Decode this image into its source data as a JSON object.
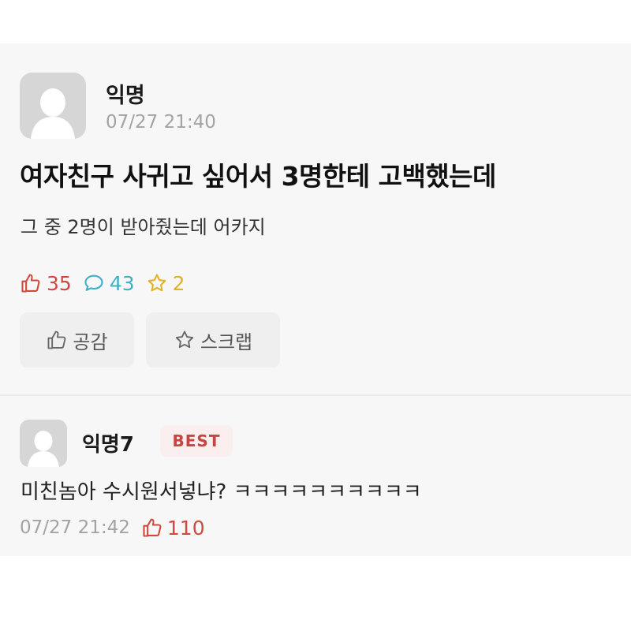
{
  "post": {
    "author": "익명",
    "date": "07/27 21:40",
    "title": "여자친구 사귀고 싶어서 3명한테 고백했는데",
    "body": "그 중 2명이 받아줬는데 어카지",
    "stats": {
      "likes": "35",
      "comments": "43",
      "scraps": "2"
    },
    "actions": {
      "empathy_label": "공감",
      "scrap_label": "스크랩"
    }
  },
  "comment": {
    "author": "익명7",
    "badge": "BEST",
    "text": "미친놈아 수시원서넣냐? ㅋㅋㅋㅋㅋㅋㅋㅋㅋㅋ",
    "date": "07/27 21:42",
    "likes": "110"
  },
  "colors": {
    "like": "#cf4a3c",
    "comment": "#3fb0c7",
    "scrap": "#e3b12d",
    "best_badge_text": "#c94343",
    "best_badge_bg": "#fbeeee"
  },
  "icons": [
    "avatar-placeholder-icon",
    "thumbs-up-icon",
    "speech-bubble-icon",
    "star-icon"
  ]
}
